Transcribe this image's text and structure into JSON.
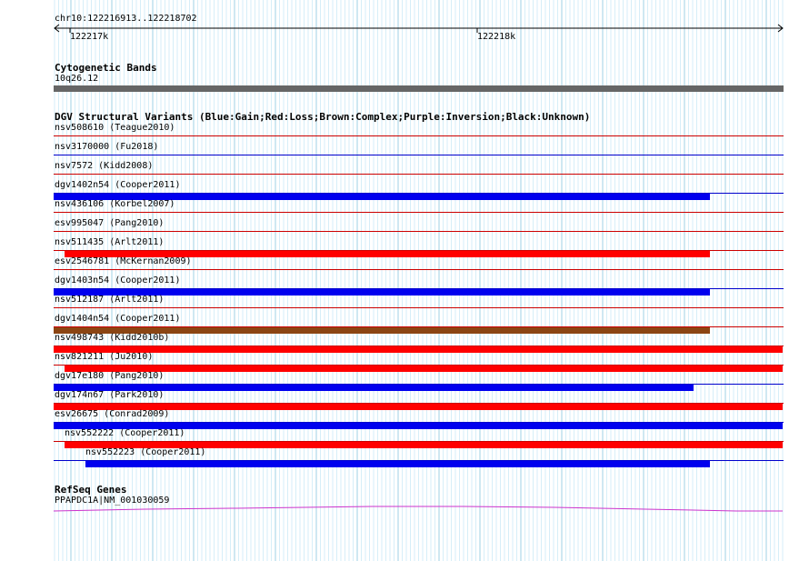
{
  "position": "chr10:122216913..122218702",
  "ruler": {
    "ticks": [
      "122217k",
      "122218k"
    ]
  },
  "cytobands": {
    "title": "Cytogenetic Bands",
    "band": "10q26.12"
  },
  "dgv": {
    "title": "DGV Structural Variants (Blue:Gain;Red:Loss;Brown:Complex;Purple:Inversion;Black:Unknown)",
    "colors": {
      "gain": "#0000ee",
      "loss": "#ff0000",
      "complex": "#8b4513",
      "separator_red": "#cc0000",
      "separator_blue": "#0000cc"
    },
    "items": [
      {
        "label": "nsv508610 (Teague2010)",
        "type": "loss",
        "bar": false
      },
      {
        "label": "nsv3170000 (Fu2018)",
        "type": "gain",
        "bar": false
      },
      {
        "label": "nsv7572 (Kidd2008)",
        "type": "loss",
        "bar": false
      },
      {
        "label": "dgv1402n54 (Cooper2011)",
        "type": "gain",
        "bar": true
      },
      {
        "label": "nsv436106 (Korbel2007)",
        "type": "loss",
        "bar": false
      },
      {
        "label": "esv995047 (Pang2010)",
        "type": "loss",
        "bar": false
      },
      {
        "label": "nsv511435 (Arlt2011)",
        "type": "loss",
        "bar": true
      },
      {
        "label": "esv2546781 (McKernan2009)",
        "type": "loss",
        "bar": false
      },
      {
        "label": "dgv1403n54 (Cooper2011)",
        "type": "gain",
        "bar": true
      },
      {
        "label": "nsv512187 (Arlt2011)",
        "type": "loss",
        "bar": false
      },
      {
        "label": "dgv1404n54 (Cooper2011)",
        "type": "complex",
        "bar": true
      },
      {
        "label": "nsv498743 (Kidd2010b)",
        "type": "loss",
        "bar": true
      },
      {
        "label": "nsv821211 (Ju2010)",
        "type": "loss",
        "bar": true
      },
      {
        "label": "dgv17e180 (Pang2010)",
        "type": "gain",
        "bar": true
      },
      {
        "label": "dgv174n67 (Park2010)",
        "type": "loss",
        "bar": true
      },
      {
        "label": "esv26675 (Conrad2009)",
        "type": "gain",
        "bar": true
      },
      {
        "label": "nsv552222 (Cooper2011)",
        "type": "loss",
        "bar": true
      },
      {
        "label": "nsv552223 (Cooper2011)",
        "type": "gain",
        "bar": true
      }
    ]
  },
  "refseq": {
    "title": "RefSeq Genes",
    "gene": "PPAPDC1A|NM_001030059",
    "color": "#cc33cc"
  }
}
